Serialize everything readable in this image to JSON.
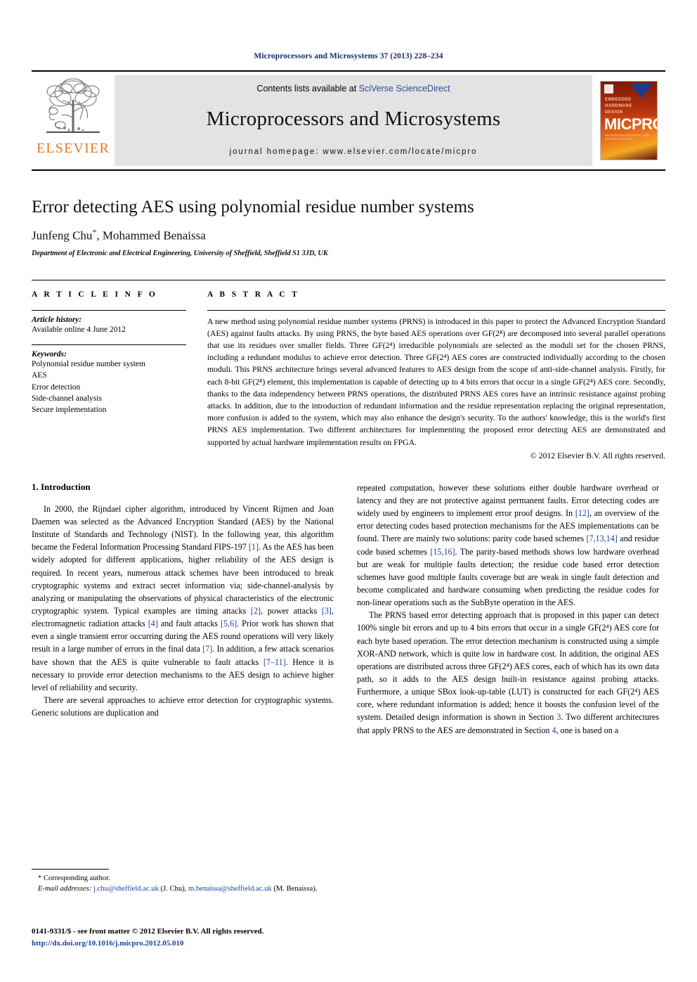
{
  "running_head": "Microprocessors and Microsystems 37 (2013) 228–234",
  "masthead": {
    "publisher_logo_text": "ELSEVIER",
    "contents_prefix": "Contents lists available at ",
    "contents_link": "SciVerse ScienceDirect",
    "journal_title": "Microprocessors and Microsystems",
    "homepage_text": "journal homepage: www.elsevier.com/locate/micpro",
    "cover": {
      "kicker": "EMBEDDED\nHARDWARE\nDESIGN",
      "kicker_line1": "EMBEDDED",
      "kicker_line2": "HARDWARE",
      "kicker_line3": "DESIGN",
      "brand": "MICPRO",
      "subtitle": "MICROPROCESSORS AND MICROSYSTEMS"
    }
  },
  "article": {
    "title": "Error detecting AES using polynomial residue number systems",
    "authors": "Junfeng Chu",
    "authors_rest": ", Mohammed Benaissa",
    "corresponding_mark": "*",
    "affiliation": "Department of Electronic and Electrical Engineering, University of Sheffield, Sheffield S1 3JD, UK"
  },
  "article_info": {
    "heading": "A R T I C L E   I N F O",
    "history_label": "Article history:",
    "history_value": "Available online 4 June 2012",
    "keywords_label": "Keywords:",
    "keywords": [
      "Polynomial residue number system",
      "AES",
      "Error detection",
      "Side-channel analysis",
      "Secure implementation"
    ]
  },
  "abstract": {
    "heading": "A B S T R A C T",
    "text": "A new method using polynomial residue number systems (PRNS) is introduced in this paper to protect the Advanced Encryption Standard (AES) against faults attacks. By using PRNS, the byte based AES operations over GF(2⁸) are decomposed into several parallel operations that use its residues over smaller fields. Three GF(2⁴) irreducible polynomials are selected as the moduli set for the chosen PRNS, including a redundant modulus to achieve error detection. Three GF(2⁴) AES cores are constructed individually according to the chosen moduli. This PRNS architecture brings several advanced features to AES design from the scope of anti-side-channel analysis. Firstly, for each 8-bit GF(2⁸) element, this implementation is capable of detecting up to 4 bits errors that occur in a single GF(2⁴) AES core. Secondly, thanks to the data independency between PRNS operations, the distributed PRNS AES cores have an intrinsic resistance against probing attacks. In addition, due to the introduction of redundant information and the residue representation replacing the original representation, more confusion is added to the system, which may also enhance the design's security. To the authors' knowledge, this is the world's first PRNS AES implementation. Two different architectures for implementing the proposed error detecting AES are demonstrated and supported by actual hardware implementation results on FPGA.",
    "copyright": "© 2012 Elsevier B.V. All rights reserved."
  },
  "introduction": {
    "heading": "1. Introduction",
    "left_paragraph_1": "In 2000, the Rijndael cipher algorithm, introduced by Vincent Rijmen and Joan Daemen was selected as the Advanced Encryption Standard (AES) by the National Institute of Standards and Technology (NIST). In the following year, this algorithm became the Federal Information Processing Standard FIPS-197 [1]. As the AES has been widely adopted for different applications, higher reliability of the AES design is required. In recent years, numerous attack schemes have been introduced to break cryptographic systems and extract secret information via; side-channel-analysis by analyzing or manipulating the observations of physical characteristics of the electronic cryptographic system. Typical examples are timing attacks [2], power attacks [3], electromagnetic radiation attacks [4] and fault attacks [5,6]. Prior work has shown that even a single transient error occurring during the AES round operations will very likely result in a large number of errors in the final data [7]. In addition, a few attack scenarios have shown that the AES is quite vulnerable to fault attacks [7–11]. Hence it is necessary to provide error detection mechanisms to the AES design to achieve higher level of reliability and security.",
    "left_paragraph_2": "There are several approaches to achieve error detection for cryptographic systems. Generic solutions are duplication and",
    "right_paragraph_1": "repeated computation, however these solutions either double hardware overhead or latency and they are not protective against permanent faults. Error detecting codes are widely used by engineers to implement error proof designs. In [12], an overview of the error detecting codes based protection mechanisms for the AES implementations can be found. There are mainly two solutions: parity code based schemes [7,13,14] and residue code based schemes [15,16]. The parity-based methods shows low hardware overhead but are weak for multiple faults detection; the residue code based error detection schemes have good multiple faults coverage but are weak in single fault detection and become complicated and hardware consuming when predicting the residue codes for non-linear operations such as the SubByte operation in the AES.",
    "right_paragraph_2": "The PRNS based error detecting approach that is proposed in this paper can detect 100% single bit errors and up to 4 bits errors that occur in a single GF(2⁴) AES core for each byte based operation. The error detection mechanism is constructed using a simple XOR-AND network, which is quite low in hardware cost. In addition, the original AES operations are distributed across three GF(2⁴) AES cores, each of which has its own data path, so it adds to the AES design built-in resistance against probing attacks. Furthermore, a unique SBox look-up-table (LUT) is constructed for each GF(2⁴) AES core, where redundant information is added; hence it boosts the confusion level of the system. Detailed design information is shown in Section 3. Two different architectures that apply PRNS to the AES are demonstrated in Section 4, one is based on a"
  },
  "footnote": {
    "corresponding": "* Corresponding author.",
    "email_label": "E-mail addresses:",
    "email_1": "j.chu@sheffield.ac.uk",
    "email_1_owner": "(J. Chu),",
    "email_2": "m.benaissa@sheffield.ac.uk",
    "email_2_owner": "(M. Benaissa)."
  },
  "imprint": {
    "line1": "0141-9331/$ - see front matter © 2012 Elsevier B.V. All rights reserved.",
    "doi": "http://dx.doi.org/10.1016/j.micpro.2012.05.010"
  },
  "colors": {
    "link": "#1a3fa0",
    "runhead": "#1a2a6c",
    "elsevier_orange": "#E87722",
    "masthead_grey": "#e3e3e3"
  }
}
